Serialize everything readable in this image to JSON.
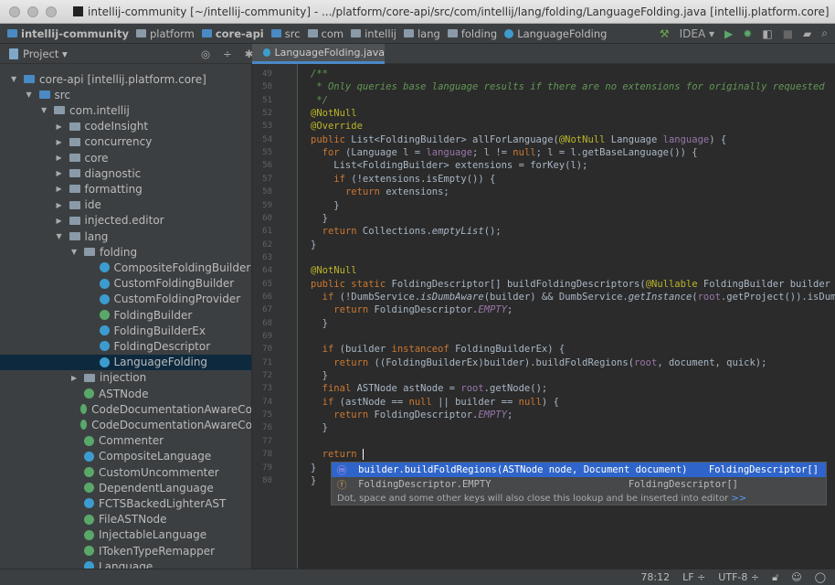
{
  "window": {
    "title": "intellij-community [~/intellij-community] - .../platform/core-api/src/com/intellij/lang/folding/LanguageFolding.java [intellij.platform.core]"
  },
  "navbar": {
    "crumbs": [
      "intellij-community",
      "platform",
      "core-api",
      "src",
      "com",
      "intellij",
      "lang",
      "folding",
      "LanguageFolding"
    ],
    "run_config": "IDEA ▾"
  },
  "toolwindow": {
    "label": "Project ▾"
  },
  "editor_tab": {
    "label": "LanguageFolding.java"
  },
  "tree": [
    {
      "label": "core-api [intellij.platform.core]",
      "depth": 0,
      "kind": "module",
      "open": true
    },
    {
      "label": "src",
      "depth": 1,
      "kind": "srcfolder",
      "open": true
    },
    {
      "label": "com.intellij",
      "depth": 2,
      "kind": "package",
      "open": true
    },
    {
      "label": "codeInsight",
      "depth": 3,
      "kind": "package",
      "open": false
    },
    {
      "label": "concurrency",
      "depth": 3,
      "kind": "package",
      "open": false
    },
    {
      "label": "core",
      "depth": 3,
      "kind": "package",
      "open": false
    },
    {
      "label": "diagnostic",
      "depth": 3,
      "kind": "package",
      "open": false
    },
    {
      "label": "formatting",
      "depth": 3,
      "kind": "package",
      "open": false
    },
    {
      "label": "ide",
      "depth": 3,
      "kind": "package",
      "open": false
    },
    {
      "label": "injected.editor",
      "depth": 3,
      "kind": "package",
      "open": false
    },
    {
      "label": "lang",
      "depth": 3,
      "kind": "package",
      "open": true
    },
    {
      "label": "folding",
      "depth": 4,
      "kind": "package",
      "open": true
    },
    {
      "label": "CompositeFoldingBuilder",
      "depth": 5,
      "kind": "class"
    },
    {
      "label": "CustomFoldingBuilder",
      "depth": 5,
      "kind": "class"
    },
    {
      "label": "CustomFoldingProvider",
      "depth": 5,
      "kind": "class"
    },
    {
      "label": "FoldingBuilder",
      "depth": 5,
      "kind": "interface"
    },
    {
      "label": "FoldingBuilderEx",
      "depth": 5,
      "kind": "class"
    },
    {
      "label": "FoldingDescriptor",
      "depth": 5,
      "kind": "class"
    },
    {
      "label": "LanguageFolding",
      "depth": 5,
      "kind": "class",
      "selected": true
    },
    {
      "label": "injection",
      "depth": 4,
      "kind": "package",
      "open": false
    },
    {
      "label": "ASTNode",
      "depth": 4,
      "kind": "interface"
    },
    {
      "label": "CodeDocumentationAwareCo",
      "depth": 4,
      "kind": "interface"
    },
    {
      "label": "CodeDocumentationAwareCo",
      "depth": 4,
      "kind": "interface"
    },
    {
      "label": "Commenter",
      "depth": 4,
      "kind": "interface"
    },
    {
      "label": "CompositeLanguage",
      "depth": 4,
      "kind": "class"
    },
    {
      "label": "CustomUncommenter",
      "depth": 4,
      "kind": "interface"
    },
    {
      "label": "DependentLanguage",
      "depth": 4,
      "kind": "interface"
    },
    {
      "label": "FCTSBackedLighterAST",
      "depth": 4,
      "kind": "class"
    },
    {
      "label": "FileASTNode",
      "depth": 4,
      "kind": "interface"
    },
    {
      "label": "InjectableLanguage",
      "depth": 4,
      "kind": "interface"
    },
    {
      "label": "ITokenTypeRemapper",
      "depth": 4,
      "kind": "interface"
    },
    {
      "label": "Language",
      "depth": 4,
      "kind": "class"
    }
  ],
  "code": {
    "first_line": 49,
    "lines": [
      "/**",
      " * Only queries base language results if there are no extensions for originally requested",
      " */",
      "@NotNull",
      "@Override",
      "public List<FoldingBuilder> allForLanguage(@NotNull Language language) {",
      "  for (Language l = language; l != null; l = l.getBaseLanguage()) {",
      "    List<FoldingBuilder> extensions = forKey(l);",
      "    if (!extensions.isEmpty()) {",
      "      return extensions;",
      "    }",
      "  }",
      "  return Collections.emptyList();",
      "}",
      "",
      "@NotNull",
      "public static FoldingDescriptor[] buildFoldingDescriptors(@Nullable FoldingBuilder builder",
      "  if (!DumbService.isDumbAware(builder) && DumbService.getInstance(root.getProject()).isDum",
      "    return FoldingDescriptor.EMPTY;",
      "  }",
      "",
      "  if (builder instanceof FoldingBuilderEx) {",
      "    return ((FoldingBuilderEx)builder).buildFoldRegions(root, document, quick);",
      "  }",
      "  final ASTNode astNode = root.getNode();",
      "  if (astNode == null || builder == null) {",
      "    return FoldingDescriptor.EMPTY;",
      "  }",
      "",
      "  return ",
      "}",
      "}"
    ]
  },
  "completion": {
    "items": [
      {
        "text": "builder.buildFoldRegions(ASTNode node, Document document)",
        "type": "FoldingDescriptor[]"
      },
      {
        "text": "FoldingDescriptor.EMPTY",
        "type": "FoldingDescriptor[]"
      }
    ],
    "hint": "Dot, space and some other keys will also close this lookup and be inserted into editor",
    "hint_link": ">>"
  },
  "status": {
    "position": "78:12",
    "line_sep": "LF ÷",
    "encoding": "UTF-8 ÷"
  },
  "colors": {
    "accent": "#4a88c7",
    "selection": "#2f65ca",
    "keyword": "#cc7832",
    "annotation": "#bbb529",
    "comment": "#629755",
    "param": "#72737a"
  }
}
